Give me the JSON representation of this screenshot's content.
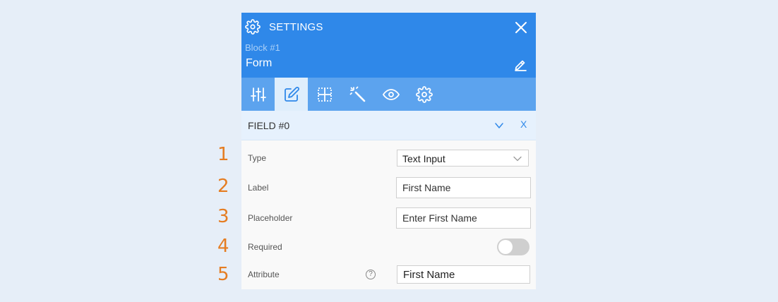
{
  "header": {
    "title": "SETTINGS",
    "block_label": "Block #1",
    "form_name": "Form"
  },
  "icons": {
    "header": [
      "gear-icon",
      "close-icon",
      "pencil-icon"
    ],
    "toolbar": [
      "sliders-icon",
      "edit-icon",
      "grid-icon",
      "magic-wand-icon",
      "eye-icon",
      "gear-icon"
    ],
    "field": [
      "chevron-down-icon",
      "close-icon",
      "help-icon"
    ]
  },
  "toolbar": {
    "active_index": 1
  },
  "field": {
    "title": "FIELD #0",
    "collapse_label": "v",
    "close_label": "X",
    "numbers": [
      "1",
      "2",
      "3",
      "4",
      "5"
    ],
    "type": {
      "label": "Type",
      "value": "Text Input"
    },
    "label": {
      "label": "Label",
      "value": "First Name"
    },
    "placeholder": {
      "label": "Placeholder",
      "value": "Enter First Name"
    },
    "required": {
      "label": "Required",
      "value": false
    },
    "attribute": {
      "label": "Attribute",
      "value": "First Name",
      "help": "?"
    }
  },
  "colors": {
    "header_bg": "#2f88e9",
    "toolbar_bg": "#5ca3ee",
    "toolbar_active_bg": "#dfeefc",
    "field_head_bg": "#e6f1fd",
    "number_color": "#e57d22",
    "toggle_off": "#cfcfcf"
  }
}
